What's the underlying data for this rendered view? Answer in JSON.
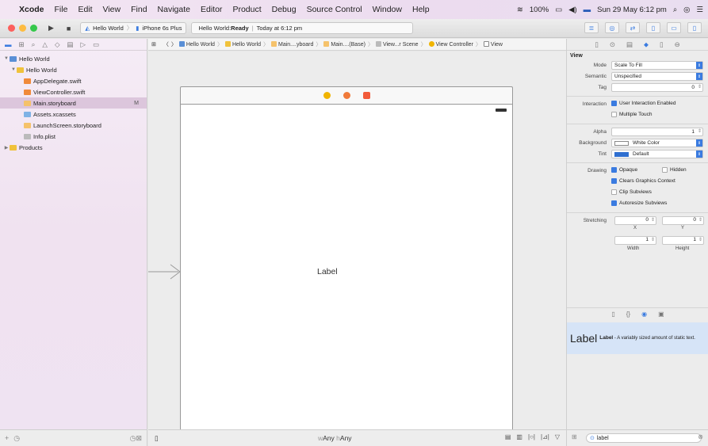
{
  "menubar": {
    "app": "Xcode",
    "items": [
      "File",
      "Edit",
      "View",
      "Find",
      "Navigate",
      "Editor",
      "Product",
      "Debug",
      "Source Control",
      "Window",
      "Help"
    ],
    "battery": "100%",
    "clock": "Sun 29 May  6:12 pm"
  },
  "toolbar": {
    "scheme": "Hello World",
    "device": "iPhone 6s Plus",
    "status_prefix": "Hello World: ",
    "status_state": "Ready",
    "status_time": "Today at 6:12 pm"
  },
  "navigator": {
    "items": [
      {
        "label": "Hello World",
        "level": 0,
        "disclosure": "▼",
        "icon_color": "#5a8fd6"
      },
      {
        "label": "Hello World",
        "level": 1,
        "disclosure": "▼",
        "icon_color": "#f0c23b"
      },
      {
        "label": "AppDelegate.swift",
        "level": 2,
        "disclosure": "",
        "icon_color": "#f08a3a"
      },
      {
        "label": "ViewController.swift",
        "level": 2,
        "disclosure": "",
        "icon_color": "#f08a3a"
      },
      {
        "label": "Main.storyboard",
        "level": 2,
        "disclosure": "",
        "icon_color": "#f5c26b",
        "badge": "M",
        "selected": true
      },
      {
        "label": "Assets.xcassets",
        "level": 2,
        "disclosure": "",
        "icon_color": "#7fb2e5"
      },
      {
        "label": "LaunchScreen.storyboard",
        "level": 2,
        "disclosure": "",
        "icon_color": "#f5c26b"
      },
      {
        "label": "Info.plist",
        "level": 2,
        "disclosure": "",
        "icon_color": "#bbbbbb"
      },
      {
        "label": "Products",
        "level": 0,
        "disclosure": "▶",
        "icon_color": "#f0c23b"
      }
    ]
  },
  "jumpbar": {
    "crumbs": [
      "Hello World",
      "Hello World",
      "Main....yboard",
      "Main....(Base)",
      "View...r Scene",
      "View Controller",
      "View"
    ]
  },
  "canvas": {
    "label": "Label",
    "size_class_w": "w",
    "size_class_w_value": "Any",
    "size_class_h": "h",
    "size_class_h_value": "Any"
  },
  "inspector": {
    "section": "View",
    "mode": "Scale To Fill",
    "semantic": "Unspecified",
    "tag": "0",
    "interaction_user": "User Interaction Enabled",
    "interaction_multi": "Multiple Touch",
    "alpha": "1",
    "background": "White Color",
    "tint": "Default",
    "drawing_opaque": "Opaque",
    "drawing_hidden": "Hidden",
    "drawing_clears": "Clears Graphics Context",
    "drawing_clip": "Clip Subviews",
    "drawing_autoresize": "Autoresize Subviews",
    "stretch_x": "0",
    "stretch_y": "0",
    "stretch_w": "1",
    "stretch_h": "1",
    "labels": {
      "mode": "Mode",
      "semantic": "Semantic",
      "tag": "Tag",
      "interaction": "Interaction",
      "alpha": "Alpha",
      "background": "Background",
      "tint": "Tint",
      "drawing": "Drawing",
      "stretching": "Stretching",
      "x": "X",
      "y": "Y",
      "width": "Width",
      "height": "Height"
    }
  },
  "library": {
    "big": "Label",
    "title": "Label",
    "desc": " - A variably sized amount of static text."
  },
  "filter": {
    "value": "label"
  },
  "colors": {
    "accent": "#3a7be0",
    "selection": "#dcc6dc"
  }
}
